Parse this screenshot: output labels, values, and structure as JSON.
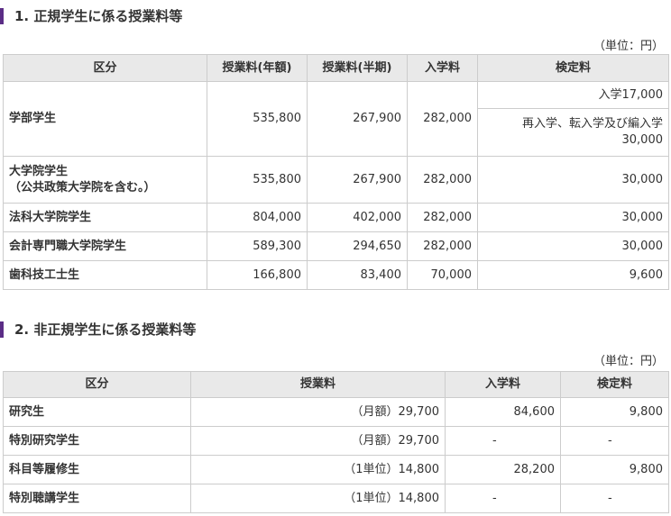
{
  "section1": {
    "heading": "1. 正規学生に係る授業料等",
    "unit": "（単位：円）",
    "headers": [
      "区分",
      "授業料(年額)",
      "授業料(半期)",
      "入学料",
      "検定料"
    ],
    "undergrad": {
      "label": "学部学生",
      "annual": "535,800",
      "half": "267,900",
      "admission": "282,000",
      "exam_a": "入学17,000",
      "exam_b_line1": "再入学、転入学及び編入学",
      "exam_b_line2": "30,000"
    },
    "rows": [
      {
        "label": "大学院学生",
        "label2": "（公共政策大学院を含む。）",
        "annual": "535,800",
        "half": "267,900",
        "admission": "282,000",
        "exam": "30,000"
      },
      {
        "label": "法科大学院学生",
        "annual": "804,000",
        "half": "402,000",
        "admission": "282,000",
        "exam": "30,000"
      },
      {
        "label": "会計専門職大学院学生",
        "annual": "589,300",
        "half": "294,650",
        "admission": "282,000",
        "exam": "30,000"
      },
      {
        "label": "歯科技工士生",
        "annual": "166,800",
        "half": "83,400",
        "admission": "70,000",
        "exam": "9,600"
      }
    ]
  },
  "section2": {
    "heading": "2. 非正規学生に係る授業料等",
    "unit": "（単位：円）",
    "headers": [
      "区分",
      "授業料",
      "入学料",
      "検定料"
    ],
    "rows": [
      {
        "label": "研究生",
        "tuition": "（月額）29,700",
        "admission": "84,600",
        "exam": "9,800"
      },
      {
        "label": "特別研究学生",
        "tuition": "（月額）29,700",
        "admission": "-",
        "exam": "-"
      },
      {
        "label": "科目等履修生",
        "tuition": "（1単位）14,800",
        "admission": "28,200",
        "exam": "9,800"
      },
      {
        "label": "特別聴講学生",
        "tuition": "（1単位）14,800",
        "admission": "-",
        "exam": "-"
      }
    ]
  }
}
